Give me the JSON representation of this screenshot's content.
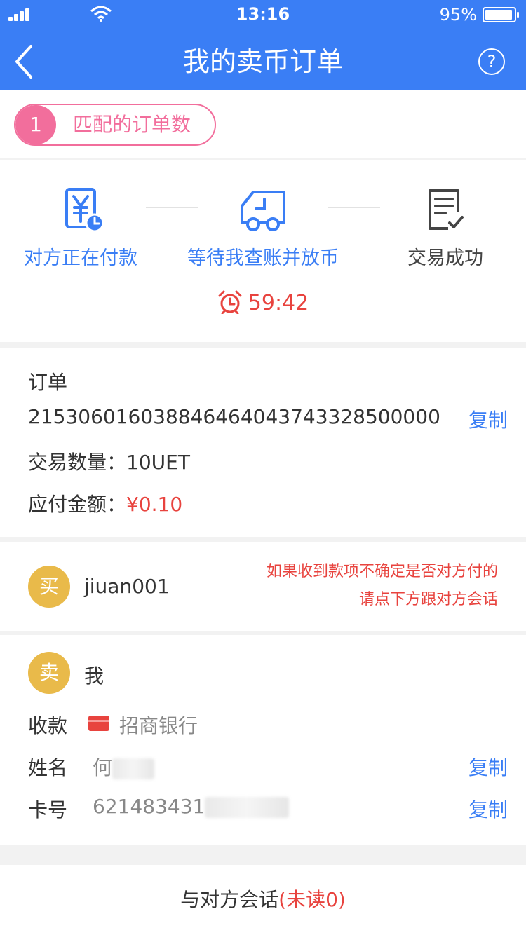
{
  "status": {
    "time": "13:16",
    "battery": "95%",
    "battery_level": 0.95
  },
  "header": {
    "title": "我的卖币订单",
    "help": "?"
  },
  "match": {
    "count": "1",
    "label": "匹配的订单数"
  },
  "steps": [
    {
      "label": "对方正在付款",
      "icon": "yuan-payment-icon"
    },
    {
      "label": "等待我查账并放币",
      "icon": "truck-clock-icon"
    },
    {
      "label": "交易成功",
      "icon": "document-check-icon"
    }
  ],
  "timer": "59:42",
  "colors": {
    "primary": "#3a7ef5",
    "accent_red": "#e8433e",
    "pink": "#f26e9c",
    "gold": "#e9ba4a"
  },
  "order": {
    "label": "订单",
    "number": "215306016038846464043743328500000",
    "copy": "复制",
    "qty_label": "交易数量：",
    "qty": "10UET",
    "amount_label": "应付金额：",
    "amount": "¥0.10"
  },
  "buyer": {
    "badge": "买",
    "name": "jiuan001",
    "notice_line1": "如果收到款项不确定是否对方付的",
    "notice_line2": "请点下方跟对方会话"
  },
  "seller": {
    "badge": "卖",
    "name": "我",
    "pay_label": "收款",
    "bank": "招商银行",
    "name_label": "姓名",
    "name_value": "何",
    "card_label": "卡号",
    "card_value": "621483431",
    "copy": "复制"
  },
  "chat": {
    "label": "与对方会话",
    "unread": "(未读0)"
  }
}
